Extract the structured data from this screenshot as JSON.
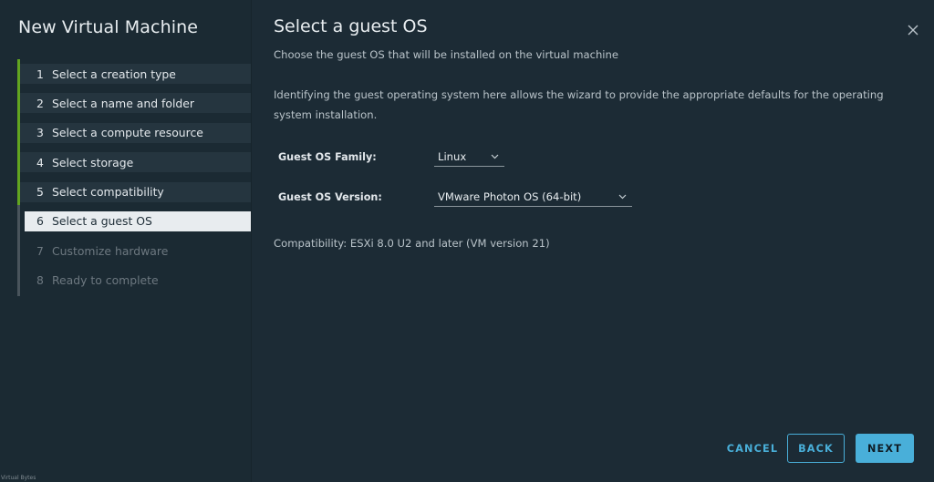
{
  "sidebar": {
    "title": "New Virtual Machine",
    "steps": [
      {
        "num": "1",
        "label": "Select a creation type"
      },
      {
        "num": "2",
        "label": "Select a name and folder"
      },
      {
        "num": "3",
        "label": "Select a compute resource"
      },
      {
        "num": "4",
        "label": "Select storage"
      },
      {
        "num": "5",
        "label": "Select compatibility"
      },
      {
        "num": "6",
        "label": "Select a guest OS"
      },
      {
        "num": "7",
        "label": "Customize hardware"
      },
      {
        "num": "8",
        "label": "Ready to complete"
      }
    ],
    "watermark": "Virtual Bytes"
  },
  "main": {
    "title": "Select a guest OS",
    "subtitle": "Choose the guest OS that will be installed on the virtual machine",
    "description": "Identifying the guest operating system here allows the wizard to provide the appropriate defaults for the operating system installation.",
    "form": {
      "family_label": "Guest OS Family:",
      "family_value": "Linux",
      "version_label": "Guest OS Version:",
      "version_value": "VMware Photon OS (64-bit)"
    },
    "compatibility": "Compatibility: ESXi 8.0 U2 and later (VM version 21)"
  },
  "footer": {
    "cancel_label": "CANCEL",
    "back_label": "BACK",
    "next_label": "NEXT"
  },
  "icons": {
    "close": "close-icon",
    "dropdown": "chevron-down-icon"
  },
  "colors": {
    "accent": "#49afd9",
    "progress_complete": "#62a420",
    "background": "#1c2b35"
  }
}
